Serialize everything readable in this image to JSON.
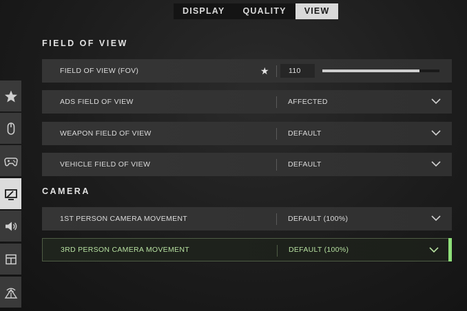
{
  "tabs": [
    {
      "label": "DISPLAY",
      "active": false
    },
    {
      "label": "QUALITY",
      "active": false
    },
    {
      "label": "VIEW",
      "active": true
    }
  ],
  "sections": {
    "fov_title": "FIELD OF VIEW",
    "camera_title": "CAMERA"
  },
  "fov": {
    "label": "FIELD OF VIEW (FOV)",
    "value": "110",
    "slider_fraction": 0.83
  },
  "rows": {
    "ads": {
      "label": "ADS FIELD OF VIEW",
      "value": "AFFECTED"
    },
    "weapon": {
      "label": "WEAPON FIELD OF VIEW",
      "value": "DEFAULT"
    },
    "vehicle": {
      "label": "VEHICLE FIELD OF VIEW",
      "value": "DEFAULT"
    },
    "first_person": {
      "label": "1ST PERSON CAMERA MOVEMENT",
      "value": "DEFAULT (100%)"
    },
    "third_person": {
      "label": "3RD PERSON CAMERA MOVEMENT",
      "value": "DEFAULT (100%)"
    }
  },
  "sidebar": {
    "items": [
      {
        "icon": "star-icon"
      },
      {
        "icon": "mouse-icon"
      },
      {
        "icon": "gamepad-icon"
      },
      {
        "icon": "display-icon",
        "active": true
      },
      {
        "icon": "speaker-icon"
      },
      {
        "icon": "interface-icon"
      },
      {
        "icon": "network-icon"
      }
    ]
  },
  "colors": {
    "accent": "#8fe07a",
    "selected_text": "#b6e0a0",
    "row_bg": "#333333",
    "background": "#1c1c1c"
  }
}
